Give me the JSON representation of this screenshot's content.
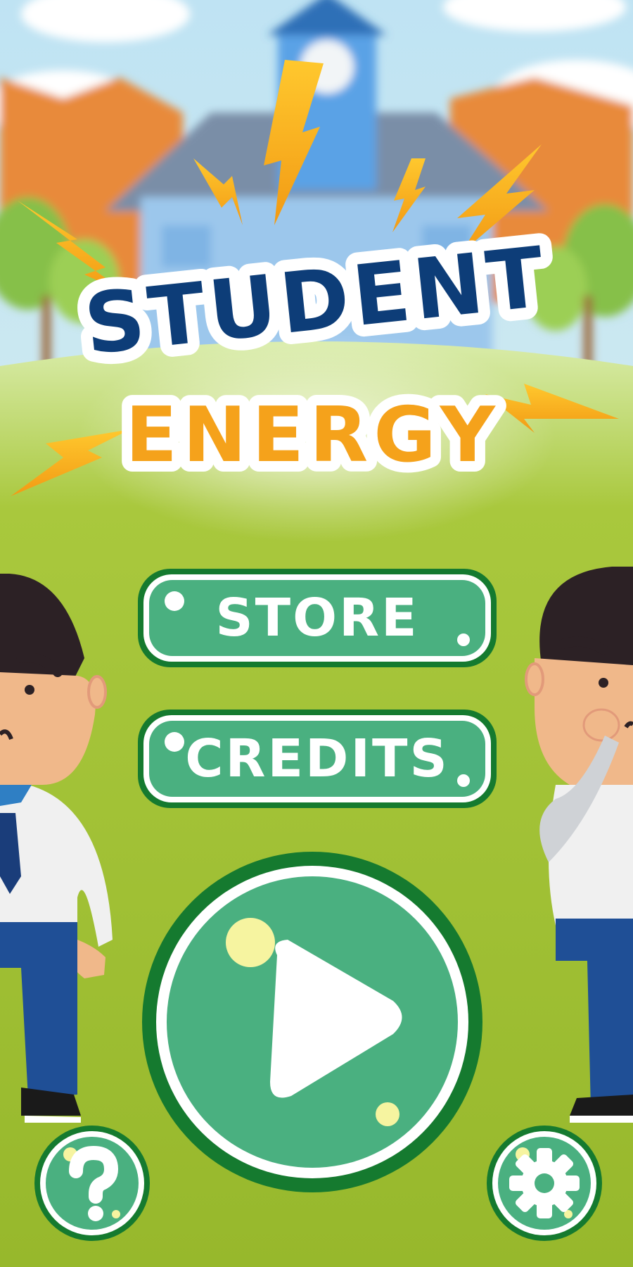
{
  "title": {
    "line1": "STUDENT",
    "line2": "ENERGY"
  },
  "menu": {
    "store_label": "STORE",
    "credits_label": "CREDITS"
  },
  "icons": {
    "play": "play-icon",
    "help": "question-mark-icon",
    "settings": "gear-icon"
  },
  "colors": {
    "button_green": "#4ab080",
    "button_border": "#157a2f",
    "title_blue": "#0d3d78",
    "title_orange": "#f5a21b",
    "grass": "#9abc2f"
  }
}
